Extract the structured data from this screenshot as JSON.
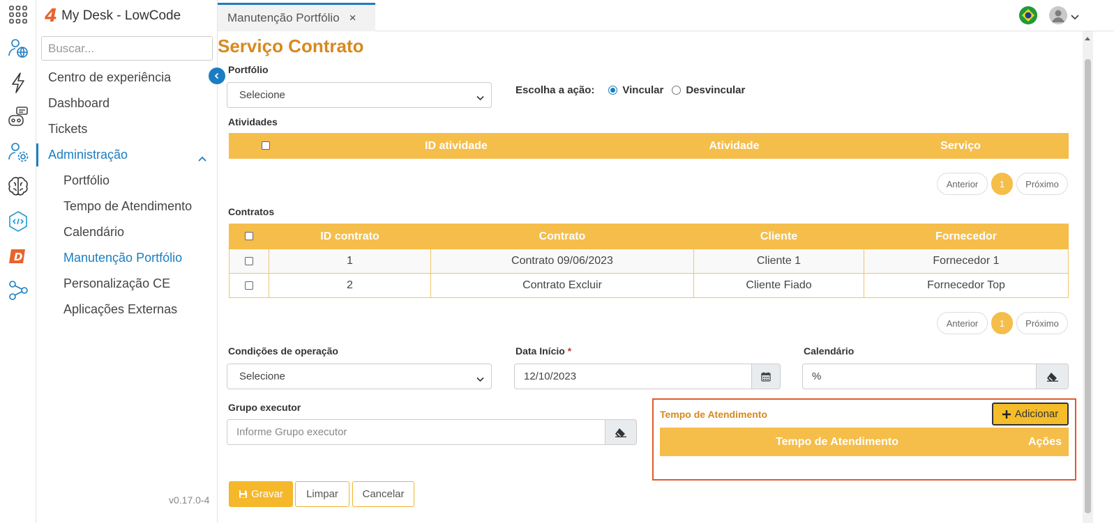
{
  "app": {
    "title": "My Desk - LowCode",
    "logo_mark": "4",
    "version": "v0.17.0-4"
  },
  "rail": {
    "icons": [
      "apps-grid-icon",
      "user-globe-icon",
      "lightning-icon",
      "chatbot-icon",
      "user-settings-icon",
      "brain-icon",
      "code-icon",
      "d-brand-icon",
      "share-nodes-icon"
    ]
  },
  "sidebar": {
    "search_placeholder": "Buscar...",
    "items": [
      {
        "label": "Centro de experiência"
      },
      {
        "label": "Dashboard"
      },
      {
        "label": "Tickets"
      },
      {
        "label": "Administração"
      }
    ],
    "subitems": [
      {
        "label": "Portfólio"
      },
      {
        "label": "Tempo de Atendimento"
      },
      {
        "label": "Calendário"
      },
      {
        "label": "Manutenção Portfólio"
      },
      {
        "label": "Personalização CE"
      },
      {
        "label": "Aplicações Externas"
      }
    ]
  },
  "tabs": [
    {
      "label": "Manutenção Portfólio",
      "close": "×"
    }
  ],
  "page": {
    "title": "Serviço Contrato",
    "portfolio_label": "Portfólio",
    "portfolio_value": "Selecione",
    "action_label": "Escolha a ação:",
    "action_options": [
      "Vincular",
      "Desvincular"
    ],
    "action_selected": "Vincular"
  },
  "atividades": {
    "label": "Atividades",
    "headers": [
      "ID atividade",
      "Atividade",
      "Serviço"
    ],
    "pager": {
      "prev": "Anterior",
      "page": "1",
      "next": "Próximo"
    }
  },
  "contratos": {
    "label": "Contratos",
    "headers": [
      "ID contrato",
      "Contrato",
      "Cliente",
      "Fornecedor"
    ],
    "rows": [
      [
        "1",
        "Contrato 09/06/2023",
        "Cliente 1",
        "Fornecedor 1"
      ],
      [
        "2",
        "Contrato Excluir",
        "Cliente Fiado",
        "Fornecedor Top"
      ]
    ],
    "pager": {
      "prev": "Anterior",
      "page": "1",
      "next": "Próximo"
    }
  },
  "form": {
    "condicoes_label": "Condições de operação",
    "condicoes_value": "Selecione",
    "data_inicio_label": "Data Início",
    "required_mark": "*",
    "data_inicio_value": "12/10/2023",
    "calendario_label": "Calendário",
    "calendario_value": "%",
    "grupo_label": "Grupo executor",
    "grupo_placeholder": "Informe Grupo executor"
  },
  "tempo_panel": {
    "title": "Tempo de Atendimento",
    "add_label": "Adicionar",
    "headers": [
      "Tempo de Atendimento",
      "Ações"
    ]
  },
  "actions": {
    "save": "Gravar",
    "clear": "Limpar",
    "cancel": "Cancelar"
  },
  "colors": {
    "accent": "#f5bd4a",
    "brand_blue": "#1b7dc1",
    "title_orange": "#d7891e",
    "highlight_border": "#e05a2b"
  }
}
